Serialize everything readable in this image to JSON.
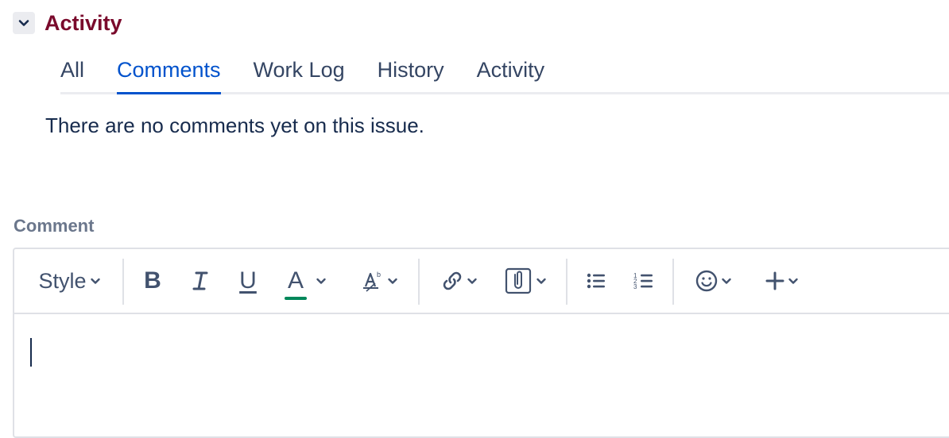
{
  "section": {
    "title": "Activity",
    "toggle_icon": "chevron-down-icon"
  },
  "tabs": [
    {
      "label": "All",
      "active": false
    },
    {
      "label": "Comments",
      "active": true
    },
    {
      "label": "Work Log",
      "active": false
    },
    {
      "label": "History",
      "active": false
    },
    {
      "label": "Activity",
      "active": false
    }
  ],
  "empty_message": "There are no comments yet on this issue.",
  "comment": {
    "label": "Comment",
    "toolbar": {
      "style_label": "Style",
      "bold_label": "B",
      "italic_label": "I",
      "underline_label": "U",
      "text_color_label": "A",
      "text_color_swatch": "#00875a",
      "icons": [
        "bold-icon",
        "italic-icon",
        "underline-icon",
        "text-color-icon",
        "text-formatting-icon",
        "link-icon",
        "attachment-icon",
        "bullet-list-icon",
        "numbered-list-icon",
        "emoji-icon",
        "plus-icon"
      ]
    },
    "value": ""
  },
  "colors": {
    "accent": "#0052cc",
    "section_title": "#7a0a2c",
    "label": "#6b778c"
  }
}
